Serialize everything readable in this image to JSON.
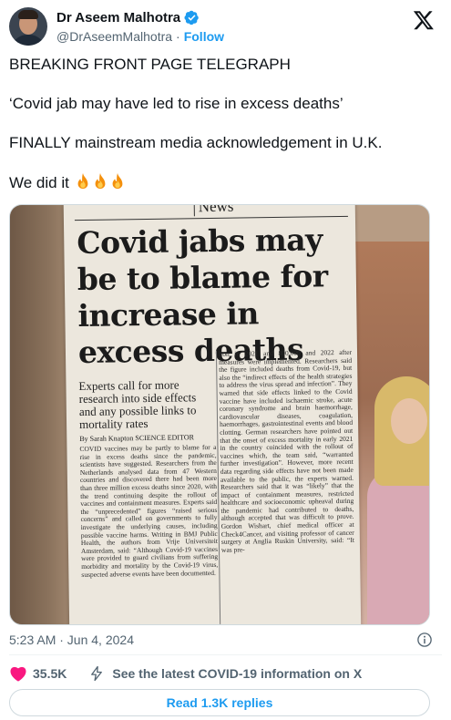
{
  "author": {
    "name": "Dr Aseem Malhotra",
    "handle": "@DrAseemMalhotra",
    "separator": "·",
    "follow_label": "Follow"
  },
  "tweet": {
    "line1": "BREAKING FRONT PAGE TELEGRAPH",
    "line2": "‘Covid jab may have led to rise in excess deaths’",
    "line3": "FINALLY mainstream media acknowledgement in U.K.",
    "line4": "We did it",
    "emoji_count": 3,
    "timestamp": "5:23 AM · Jun 4, 2024"
  },
  "photo": {
    "section": "News",
    "headline": "Covid jabs may be to blame for increase in excess deaths",
    "subhead": "Experts call for more research into side effects and any possible links to mortality rates",
    "byline": "By Sarah Knapton SCIENCE EDITOR",
    "col_a": "COVID vaccines may be partly to blame for a rise in excess deaths since the pandemic, scientists have suggested. Researchers from the Netherlands analysed data from 47 Western countries and discovered there had been more than three million excess deaths since 2020, with the trend continuing despite the rollout of vaccines and containment measures. Experts said the “unprecedented” figures “raised serious concerns” and called on governments to fully investigate the underlying causes, including possible vaccine harms. Writing in BMJ Public Health, the authors from Vrije Universiteit Amsterdam, said: “Although Covid-19 vaccines were provided to guard civilians from suffering morbidity and mortality by the Covid-19 virus, suspected adverse events have been documented.",
    "col_b": "lion in 2021 and 800,000 and 2022 after measures were implemented. Researchers said the figure included deaths from Covid-19, but also the “indirect effects of the health strategies to address the virus spread and infection”. They warned that side effects linked to the Covid vaccine have included ischaemic stroke, acute coronary syndrome and brain haemorrhage, cardiovascular diseases, coagulation, haemorrhages, gastrointestinal events and blood clotting. German researchers have pointed out that the onset of excess mortality in early 2021 in the country coincided with the rollout of vaccines which, the team said, “warranted further investigation”. However, more recent data regarding side effects have not been made available to the public, the experts warned. Researchers said that it was “likely” that the impact of containment measures, restricted healthcare and socioeconomic upheaval during the pandemic had contributed to deaths, although accepted that was difficult to prove. Gordon Wishart, chief medical officer at Check4Cancer, and visiting professor of cancer surgery at Anglia Ruskin University, said: “It was pre-"
  },
  "actions": {
    "likes": "35.5K",
    "covid_info": "See the latest COVID-19 information on X",
    "replies": "Read 1.3K replies"
  },
  "colors": {
    "accent": "#1d9bf0",
    "muted": "#536471",
    "like": "#f91880"
  },
  "icons": [
    "verified-badge-icon",
    "x-logo-icon",
    "fire-emoji-icon",
    "info-icon",
    "heart-icon",
    "lightning-bolt-icon"
  ]
}
